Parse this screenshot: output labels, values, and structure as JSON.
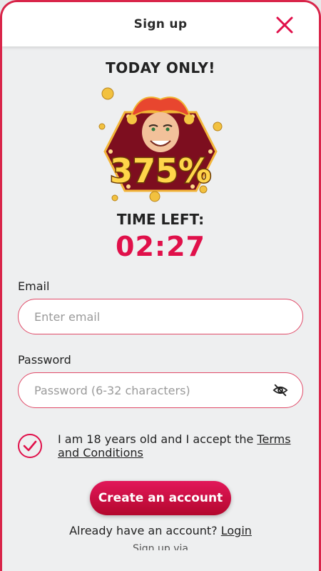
{
  "header": {
    "title": "Sign up",
    "close_icon": "close-icon"
  },
  "promo": {
    "title": "TODAY ONLY!",
    "bonus_text": "375%",
    "time_left_label": "TIME LEFT:",
    "timer": "02:27",
    "art_icon": "joker-bonus-illustration"
  },
  "form": {
    "email": {
      "label": "Email",
      "placeholder": "Enter email",
      "value": ""
    },
    "password": {
      "label": "Password",
      "placeholder": "Password (6-32 characters)",
      "value": "",
      "toggle_icon": "eye-slash-icon"
    },
    "terms": {
      "checked": true,
      "text_prefix": "I am 18 years old and I accept the ",
      "link_text": "Terms and Conditions"
    },
    "submit_label": "Create an account"
  },
  "footer": {
    "login_prompt": "Already have an account? ",
    "login_link": "Login",
    "cut_off_text": "Sign up via"
  },
  "colors": {
    "accent": "#e0104a",
    "border": "#d9254a",
    "background": "#eeeff0"
  }
}
